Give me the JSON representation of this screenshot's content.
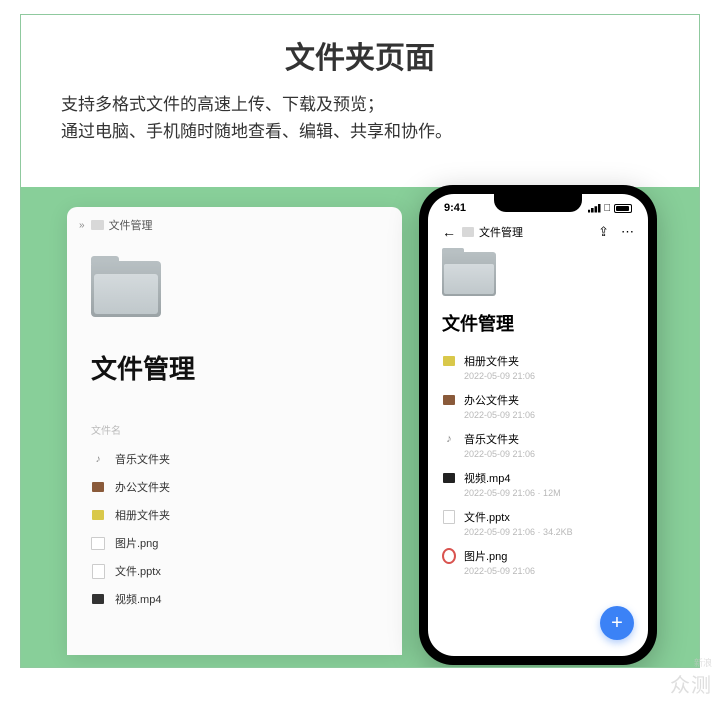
{
  "page": {
    "title": "文件夹页面",
    "description_line1": "支持多格式文件的高速上传、下载及预览；",
    "description_line2": "通过电脑、手机随时随地查看、编辑、共享和协作。"
  },
  "desktop": {
    "breadcrumb": "文件管理",
    "title": "文件管理",
    "column_header": "文件名",
    "rows": [
      {
        "name": "音乐文件夹",
        "icon": "music"
      },
      {
        "name": "办公文件夹",
        "icon": "office"
      },
      {
        "name": "相册文件夹",
        "icon": "album"
      },
      {
        "name": "图片.png",
        "icon": "image"
      },
      {
        "name": "文件.pptx",
        "icon": "pptx"
      },
      {
        "name": "视频.mp4",
        "icon": "video"
      }
    ]
  },
  "phone": {
    "time": "9:41",
    "breadcrumb": "文件管理",
    "title": "文件管理",
    "rows": [
      {
        "name": "相册文件夹",
        "meta": "2022-05-09 21:06",
        "icon": "album"
      },
      {
        "name": "办公文件夹",
        "meta": "2022-05-09 21:06",
        "icon": "office"
      },
      {
        "name": "音乐文件夹",
        "meta": "2022-05-09 21:06",
        "icon": "music"
      },
      {
        "name": "视频.mp4",
        "meta": "2022-05-09 21:06 · 12M",
        "icon": "video"
      },
      {
        "name": "文件.pptx",
        "meta": "2022-05-09 21:06 · 34.2KB",
        "icon": "pptx"
      },
      {
        "name": "图片.png",
        "meta": "2022-05-09 21:06",
        "icon": "image"
      }
    ]
  },
  "watermark": {
    "brand": "众测",
    "sub": "新浪"
  }
}
